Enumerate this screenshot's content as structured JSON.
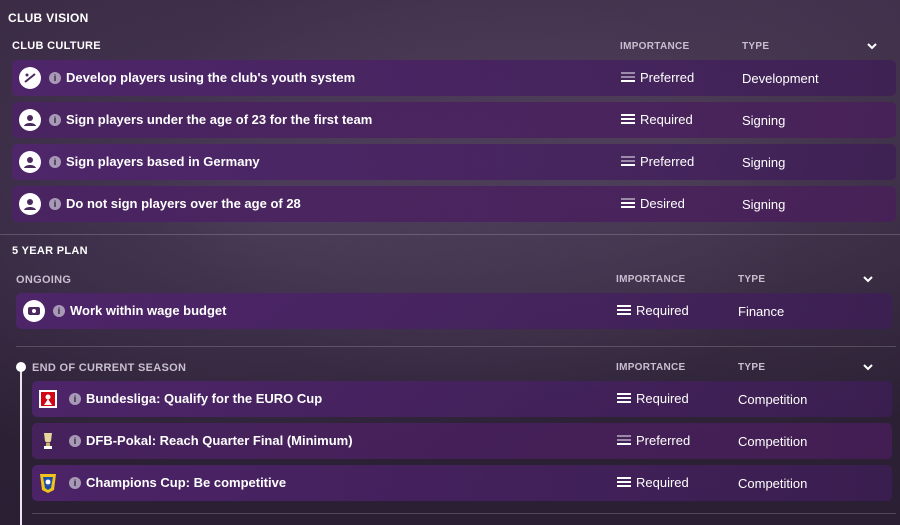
{
  "title": "CLUB VISION",
  "club_culture": {
    "title": "CLUB CULTURE",
    "col_importance": "IMPORTANCE",
    "col_type": "TYPE",
    "rows": [
      {
        "description": "Develop players using the club's youth system",
        "importance": "Preferred",
        "type": "Development"
      },
      {
        "description": "Sign players under the age of 23 for the first team",
        "importance": "Required",
        "type": "Signing"
      },
      {
        "description": "Sign players based in Germany",
        "importance": "Preferred",
        "type": "Signing"
      },
      {
        "description": "Do not sign players over the age of 28",
        "importance": "Desired",
        "type": "Signing"
      }
    ]
  },
  "five_year_plan": {
    "title": "5 YEAR PLAN",
    "ongoing": {
      "title": "ONGOING",
      "col_importance": "IMPORTANCE",
      "col_type": "TYPE",
      "rows": [
        {
          "description": "Work within wage budget",
          "importance": "Required",
          "type": "Finance"
        }
      ]
    },
    "end_of_season": {
      "title": "END OF CURRENT SEASON",
      "col_importance": "IMPORTANCE",
      "col_type": "TYPE",
      "rows": [
        {
          "description": "Bundesliga: Qualify for the EURO Cup",
          "importance": "Required",
          "type": "Competition"
        },
        {
          "description": "DFB-Pokal: Reach Quarter Final (Minimum)",
          "importance": "Preferred",
          "type": "Competition"
        },
        {
          "description": "Champions Cup: Be competitive",
          "importance": "Required",
          "type": "Competition"
        }
      ]
    }
  },
  "icons": {
    "info": "i",
    "collapse": "chevron-down-icon"
  },
  "colors": {
    "row_bg": "#4f2470",
    "accent_text": "#c8bfd0"
  }
}
